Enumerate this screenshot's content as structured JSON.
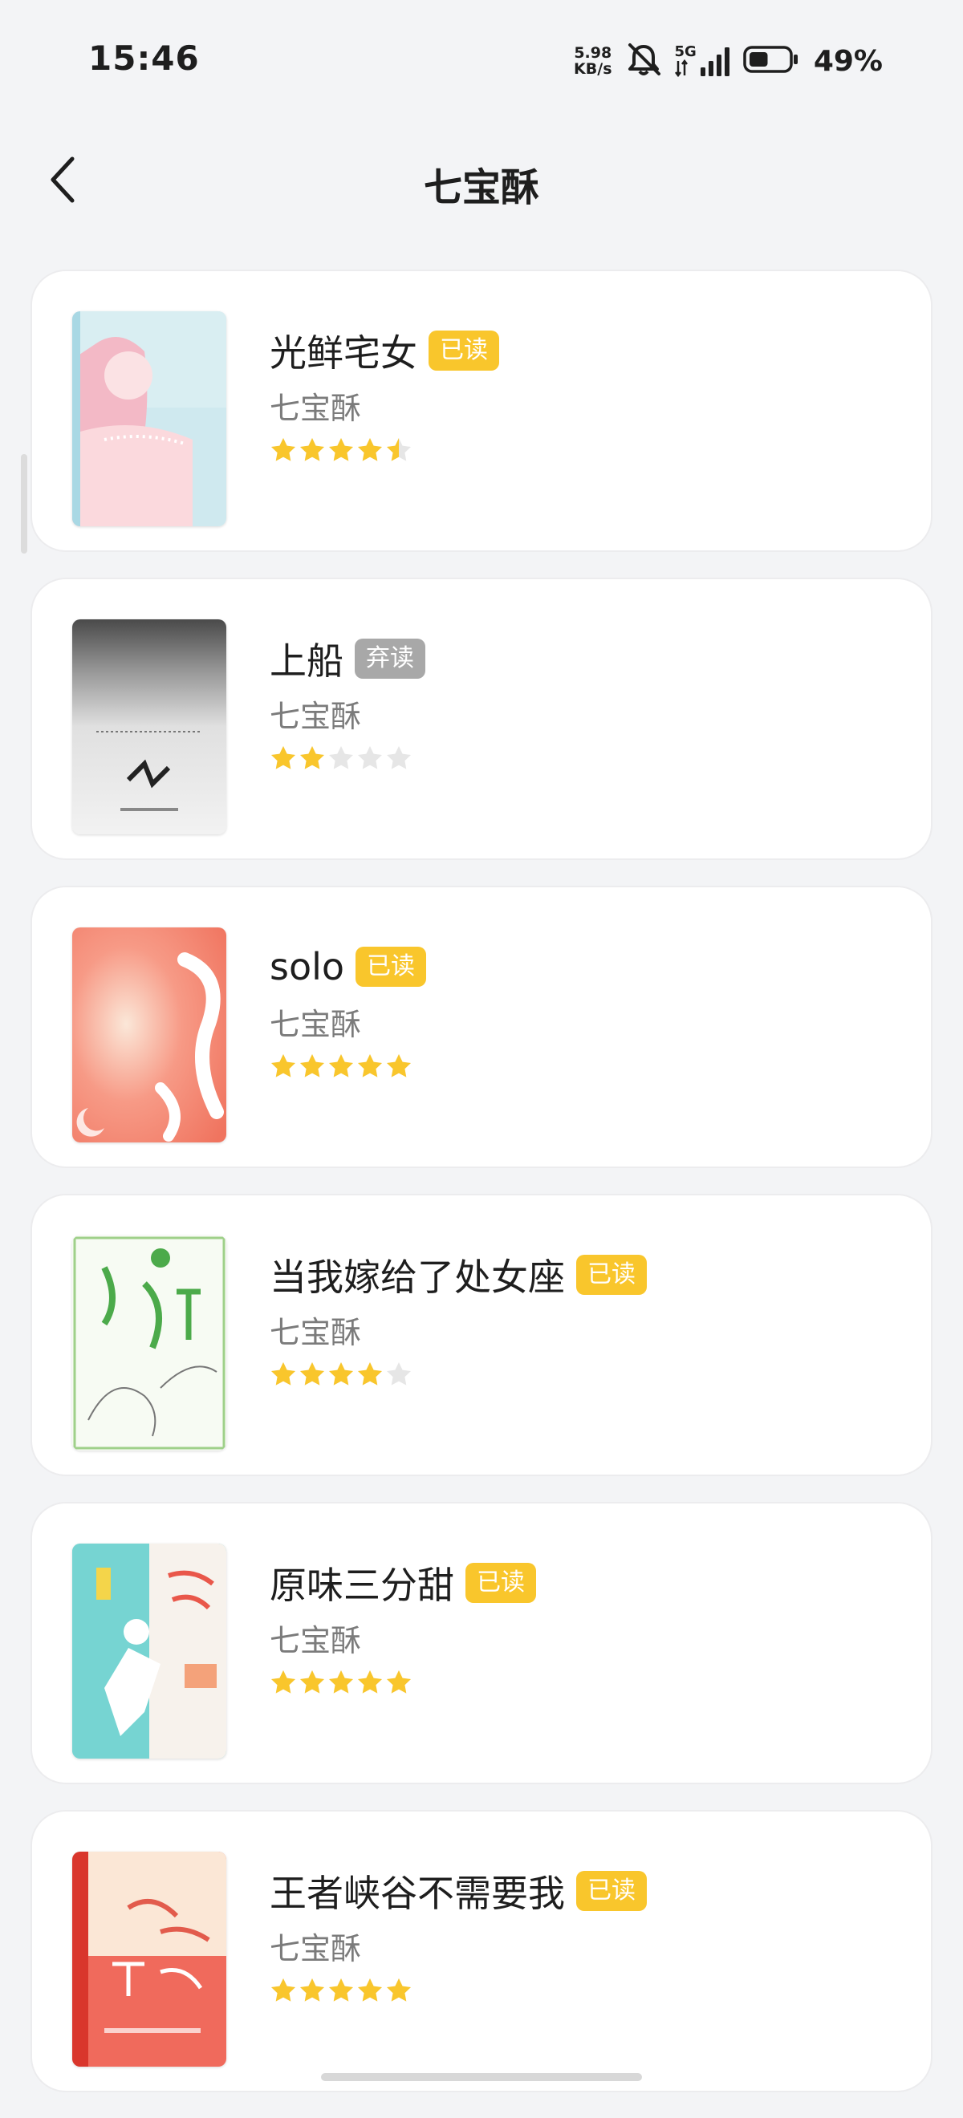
{
  "status_bar": {
    "time": "15:46",
    "net_speed_value": "5.98",
    "net_speed_unit": "KB/s",
    "network_type": "5G",
    "battery_percent": "49%",
    "battery_level": 0.49,
    "icons": [
      "mute-icon",
      "signal-icon",
      "battery-icon"
    ]
  },
  "header": {
    "title": "七宝酥",
    "back_icon": "chevron-left-icon"
  },
  "colors": {
    "background": "#f3f4f6",
    "card": "#ffffff",
    "badge_read": "#f9c62c",
    "badge_dropped": "#a8a8a8",
    "star_filled": "#f9c62c",
    "star_empty": "#e6e6e6",
    "author_text": "#7b7b7b"
  },
  "books": [
    {
      "title": "光鲜宅女",
      "status": "已读",
      "status_type": "read",
      "author": "七宝酥",
      "rating": 4.5,
      "max_rating": 5,
      "cover": "cover-guangxian"
    },
    {
      "title": "上船",
      "status": "弃读",
      "status_type": "dropped",
      "author": "七宝酥",
      "rating": 2,
      "max_rating": 5,
      "cover": "cover-shangchuan"
    },
    {
      "title": "solo",
      "status": "已读",
      "status_type": "read",
      "author": "七宝酥",
      "rating": 5,
      "max_rating": 5,
      "cover": "cover-solo"
    },
    {
      "title": "当我嫁给了处女座",
      "status": "已读",
      "status_type": "read",
      "author": "七宝酥",
      "rating": 4,
      "max_rating": 5,
      "cover": "cover-chunvzuo"
    },
    {
      "title": "原味三分甜",
      "status": "已读",
      "status_type": "read",
      "author": "七宝酥",
      "rating": 5,
      "max_rating": 5,
      "cover": "cover-yuanwei"
    },
    {
      "title": "王者峡谷不需要我",
      "status": "已读",
      "status_type": "read",
      "author": "七宝酥",
      "rating": 5,
      "max_rating": 5,
      "cover": "cover-wangzhe"
    }
  ]
}
